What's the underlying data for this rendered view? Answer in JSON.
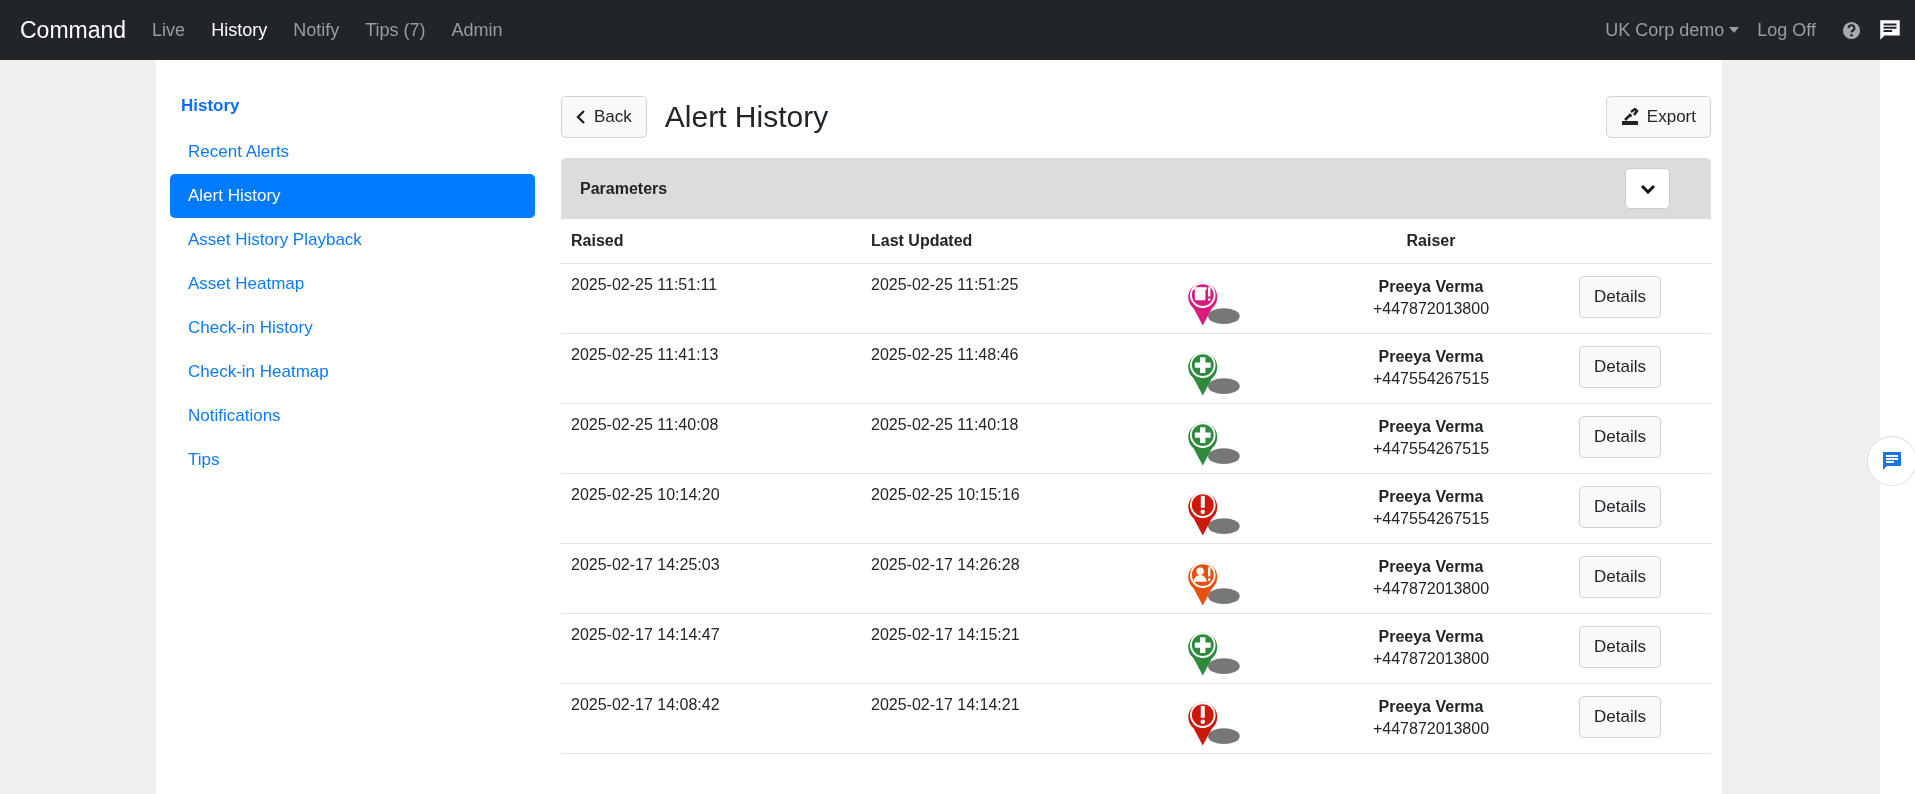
{
  "navbar": {
    "brand": "Command",
    "links": [
      {
        "label": "Live",
        "selected": false
      },
      {
        "label": "History",
        "selected": true
      },
      {
        "label": "Notify",
        "selected": false
      },
      {
        "label": "Tips (7)",
        "selected": false
      },
      {
        "label": "Admin",
        "selected": false
      }
    ],
    "account": "UK Corp demo",
    "logoff": "Log Off"
  },
  "sidebar": {
    "heading": "History",
    "items": [
      {
        "label": "Recent Alerts",
        "selected": false
      },
      {
        "label": "Alert History",
        "selected": true
      },
      {
        "label": "Asset History Playback",
        "selected": false
      },
      {
        "label": "Asset Heatmap",
        "selected": false
      },
      {
        "label": "Check-in History",
        "selected": false
      },
      {
        "label": "Check-in Heatmap",
        "selected": false
      },
      {
        "label": "Notifications",
        "selected": false
      },
      {
        "label": "Tips",
        "selected": false
      }
    ]
  },
  "page": {
    "back": "Back",
    "title": "Alert History",
    "export": "Export"
  },
  "parameters": {
    "label": "Parameters",
    "expanded": false
  },
  "table": {
    "columns": [
      "Raised",
      "Last Updated",
      "Raiser"
    ],
    "rows": [
      {
        "raised": "2025-02-25 11:51:11",
        "updated": "2025-02-25 11:51:25",
        "kind": "badge",
        "color": "#d81b7c",
        "name": "Preeya Verma",
        "phone": "+447872013800",
        "action": "Details"
      },
      {
        "raised": "2025-02-25 11:41:13",
        "updated": "2025-02-25 11:48:46",
        "kind": "cross",
        "color": "#2e8b3e",
        "name": "Preeya Verma",
        "phone": "+447554267515",
        "action": "Details"
      },
      {
        "raised": "2025-02-25 11:40:08",
        "updated": "2025-02-25 11:40:18",
        "kind": "cross",
        "color": "#2e8b3e",
        "name": "Preeya Verma",
        "phone": "+447554267515",
        "action": "Details"
      },
      {
        "raised": "2025-02-25 10:14:20",
        "updated": "2025-02-25 10:15:16",
        "kind": "exclamation",
        "color": "#cc1a0a",
        "name": "Preeya Verma",
        "phone": "+447554267515",
        "action": "Details"
      },
      {
        "raised": "2025-02-17 14:25:03",
        "updated": "2025-02-17 14:26:28",
        "kind": "person",
        "color": "#e8500f",
        "name": "Preeya Verma",
        "phone": "+447872013800",
        "action": "Details"
      },
      {
        "raised": "2025-02-17 14:14:47",
        "updated": "2025-02-17 14:15:21",
        "kind": "cross",
        "color": "#2e8b3e",
        "name": "Preeya Verma",
        "phone": "+447872013800",
        "action": "Details"
      },
      {
        "raised": "2025-02-17 14:08:42",
        "updated": "2025-02-17 14:14:21",
        "kind": "exclamation",
        "color": "#cc1a0a",
        "name": "Preeya Verma",
        "phone": "+447872013800",
        "action": "Details"
      }
    ]
  }
}
